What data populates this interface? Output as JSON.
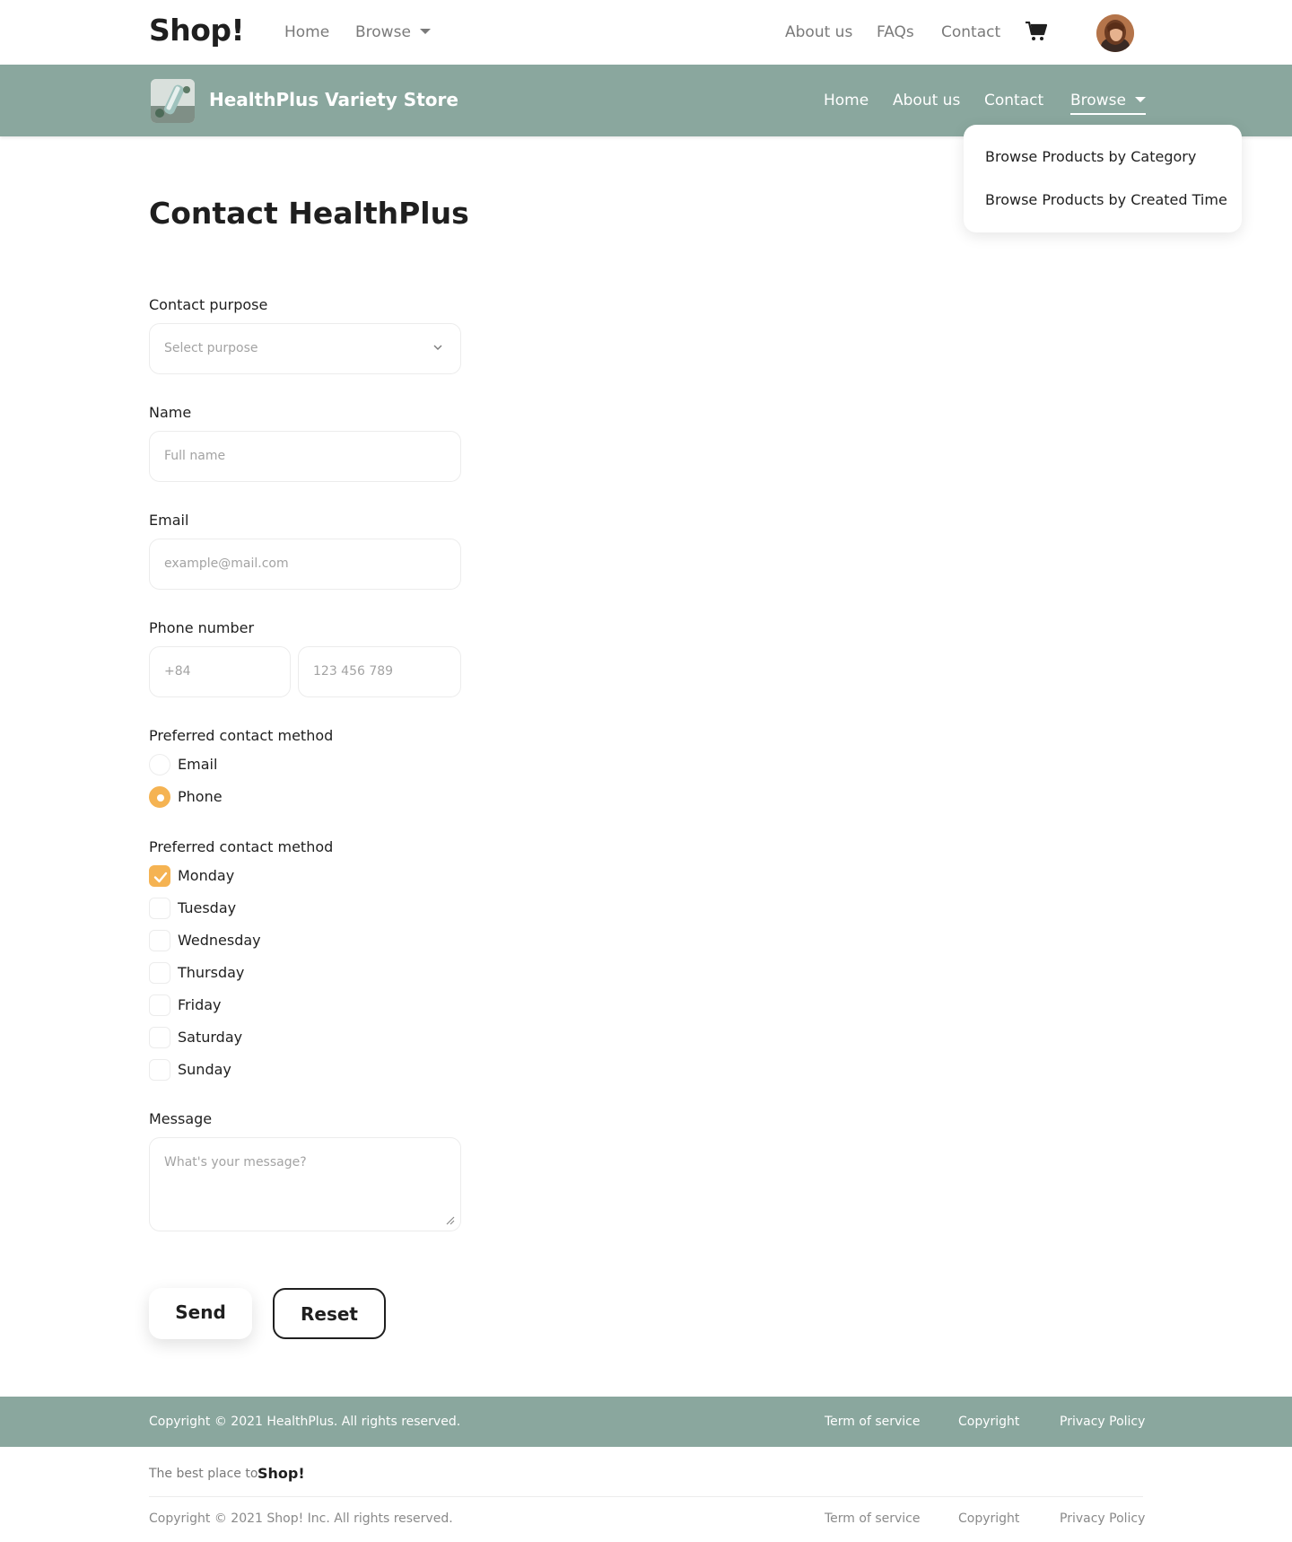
{
  "topnav": {
    "brand": "Shop!",
    "home": "Home",
    "browse": "Browse",
    "about": "About us",
    "faqs": "FAQs",
    "contact": "Contact",
    "cart_icon": "cart-icon",
    "avatar_icon": "user-avatar"
  },
  "store": {
    "name": "HealthPlus Variety Store",
    "home": "Home",
    "about": "About us",
    "contact": "Contact",
    "browse": "Browse",
    "dropdown": [
      "Browse Products by Category",
      "Browse Products by Created Time"
    ]
  },
  "form": {
    "title": "Contact HealthPlus",
    "purpose_label": "Contact purpose",
    "purpose_placeholder": "Select purpose",
    "name_label": "Name",
    "name_placeholder": "Full name",
    "email_label": "Email",
    "email_placeholder": "example@mail.com",
    "phone_label": "Phone number",
    "phone_code_placeholder": "+84",
    "phone_number_placeholder": "123 456 789",
    "method_label": "Preferred contact method",
    "methods": [
      {
        "label": "Email",
        "selected": false
      },
      {
        "label": "Phone",
        "selected": true
      }
    ],
    "days_label": "Preferred contact method",
    "days": [
      {
        "label": "Monday",
        "checked": true
      },
      {
        "label": "Tuesday",
        "checked": false
      },
      {
        "label": "Wednesday",
        "checked": false
      },
      {
        "label": "Thursday",
        "checked": false
      },
      {
        "label": "Friday",
        "checked": false
      },
      {
        "label": "Saturday",
        "checked": false
      },
      {
        "label": "Sunday",
        "checked": false
      }
    ],
    "message_label": "Message",
    "message_placeholder": "What's your message?",
    "send": "Send",
    "reset": "Reset"
  },
  "footer_store": {
    "copyright": "Copyright © 2021 HealthPlus. All rights reserved.",
    "links": [
      "Term of service",
      "Copyright",
      "Privacy Policy"
    ]
  },
  "footer_site": {
    "tagline": "The best place to",
    "brand": "Shop!",
    "copyright": "Copyright © 2021 Shop! Inc. All rights reserved.",
    "links": [
      "Term of service",
      "Copyright",
      "Privacy Policy"
    ]
  },
  "colors": {
    "store_bar": "#8aa79e",
    "accent": "#f5b352",
    "text": "#1f1f1f"
  }
}
